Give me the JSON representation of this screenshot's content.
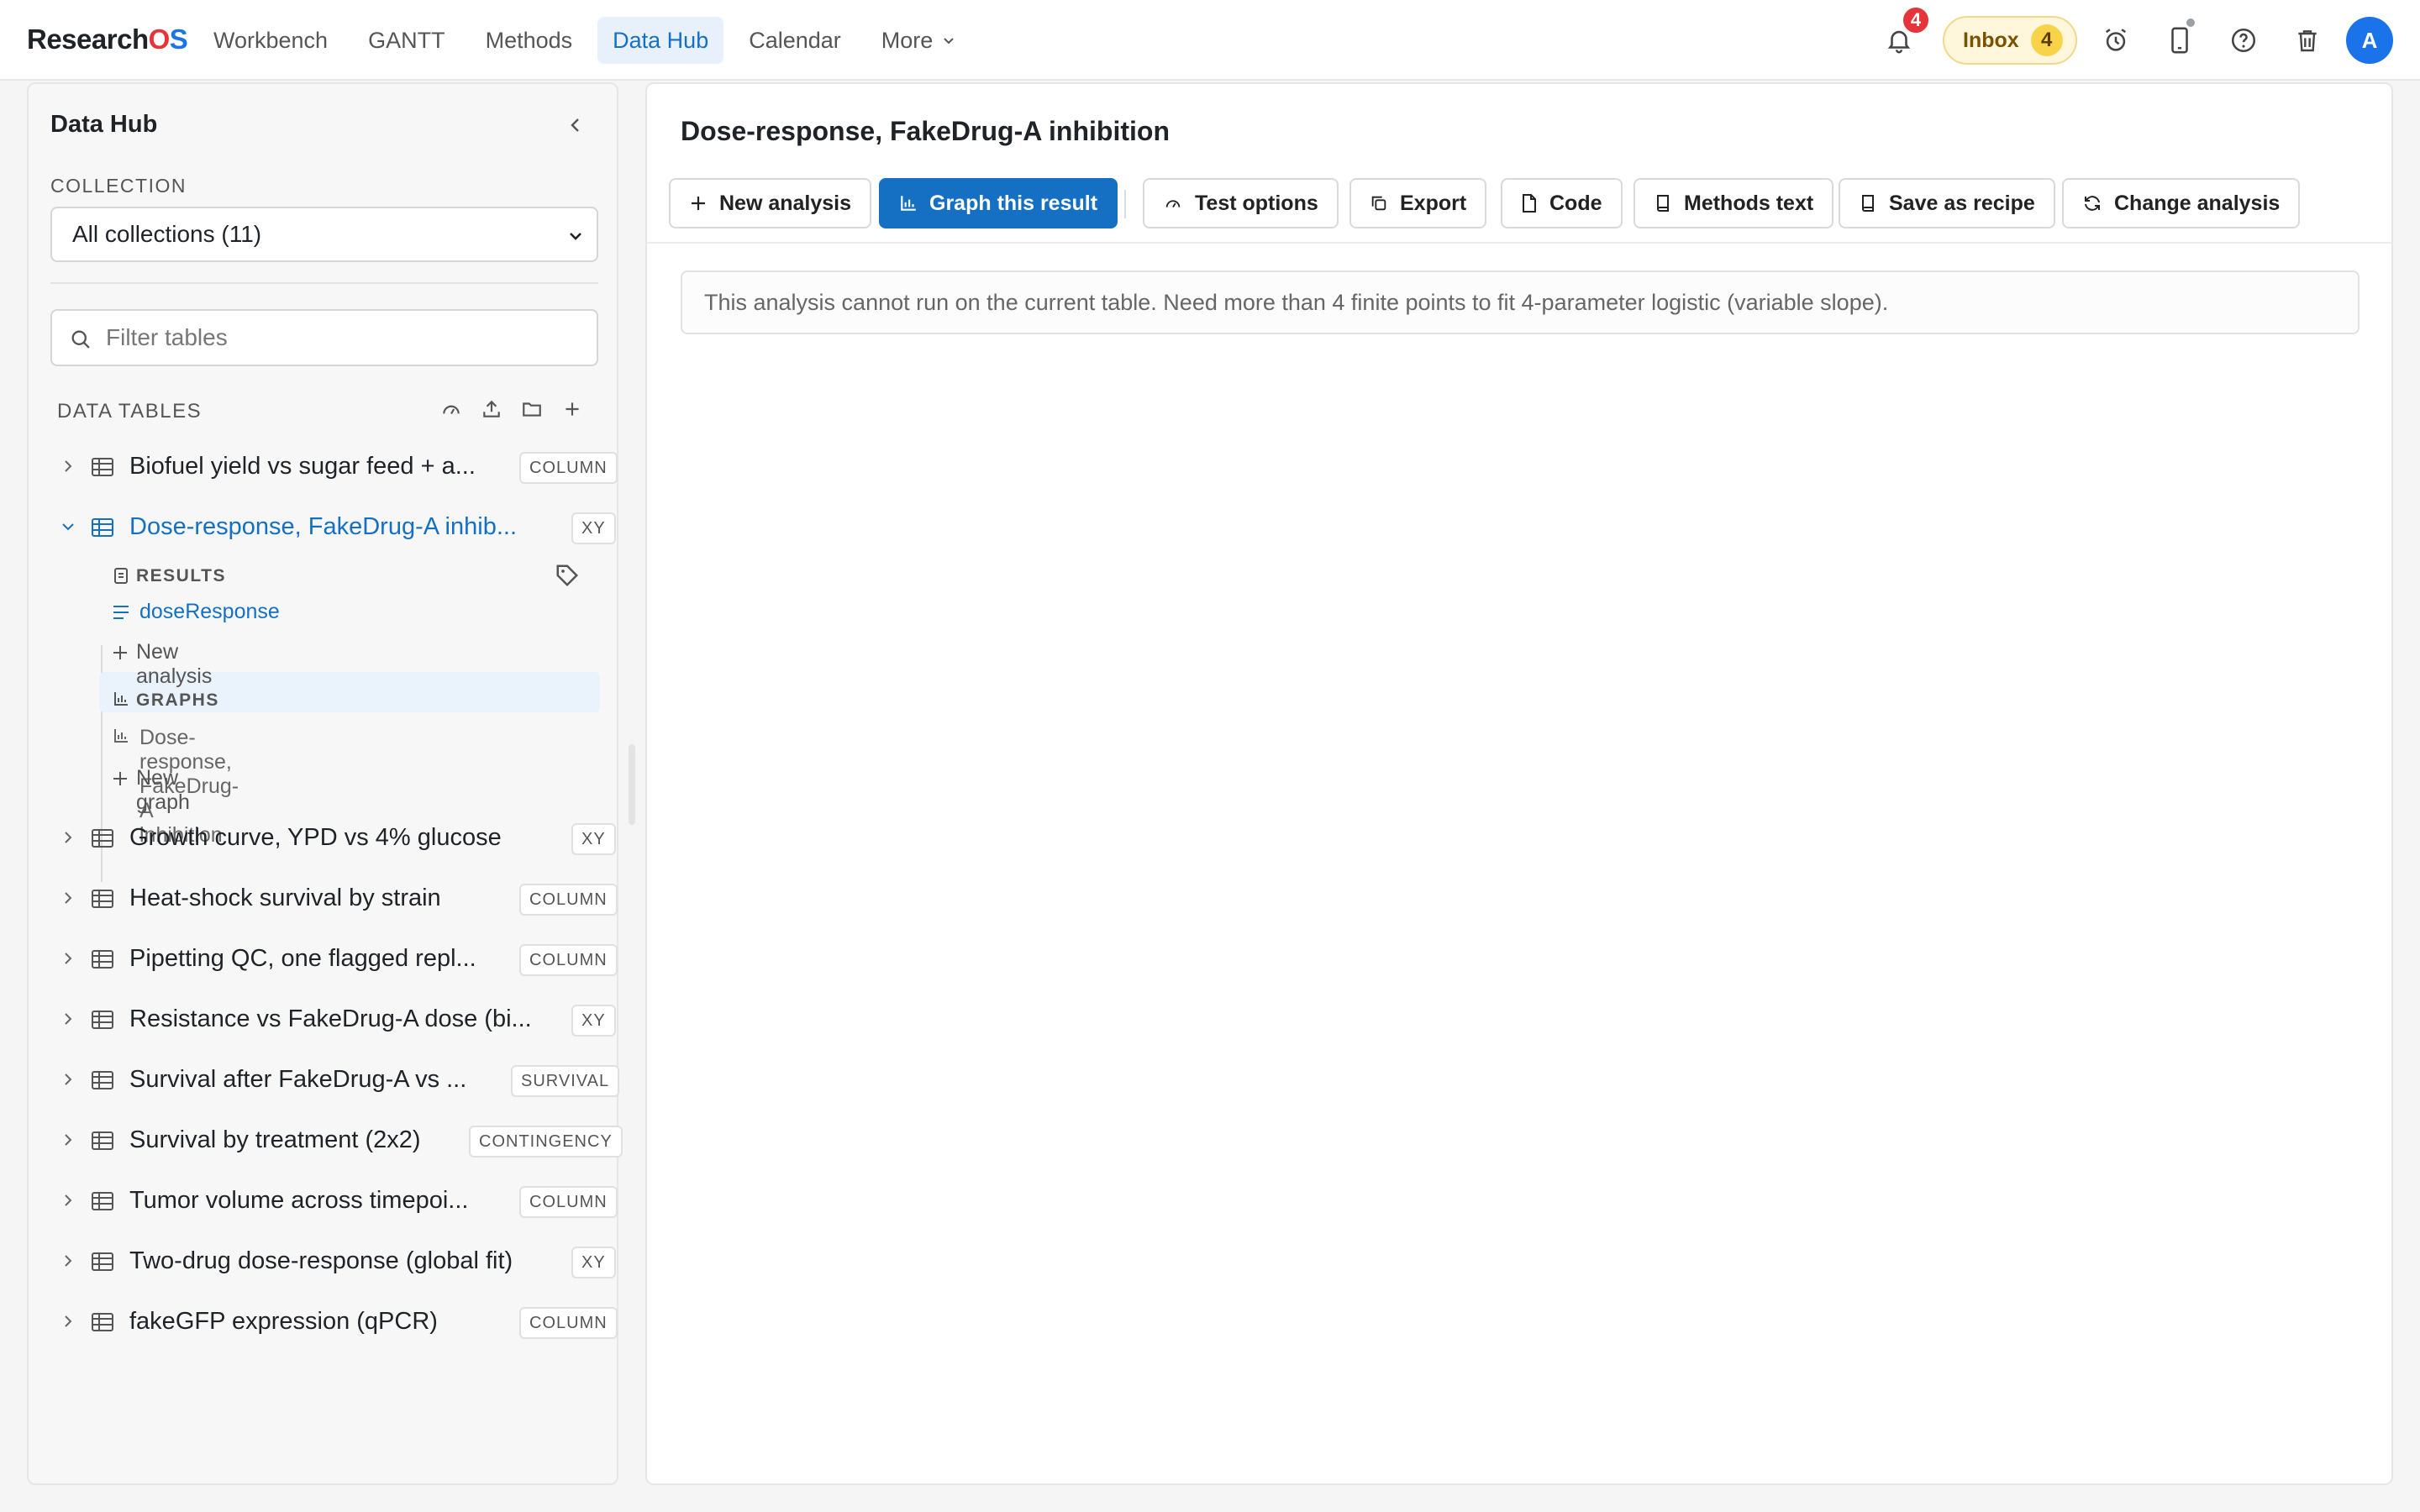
{
  "app": {
    "logo_main": "Research",
    "logo_o": "O",
    "logo_s": "S"
  },
  "nav": {
    "items": [
      "Workbench",
      "GANTT",
      "Methods",
      "Data Hub",
      "Calendar"
    ],
    "more_label": "More",
    "active": "Data Hub"
  },
  "header": {
    "notifications_count": "4",
    "inbox_label": "Inbox",
    "inbox_count": "4",
    "avatar_initial": "A"
  },
  "sidebar": {
    "title": "Data Hub",
    "collection_label": "COLLECTION",
    "collection_value": "All collections (11)",
    "filter_placeholder": "Filter tables",
    "data_tables_label": "DATA TABLES",
    "tables": [
      {
        "name": "Biofuel yield vs sugar feed + a...",
        "tag": "COLUMN"
      },
      {
        "name": "Dose-response, FakeDrug-A inhib...",
        "tag": "XY",
        "selected": true
      },
      {
        "name": "Growth curve, YPD vs 4% glucose",
        "tag": "XY"
      },
      {
        "name": "Heat-shock survival by strain",
        "tag": "COLUMN"
      },
      {
        "name": "Pipetting QC, one flagged repl...",
        "tag": "COLUMN"
      },
      {
        "name": "Resistance vs FakeDrug-A dose (bi...",
        "tag": "XY"
      },
      {
        "name": "Survival after FakeDrug-A vs ...",
        "tag": "SURVIVAL"
      },
      {
        "name": "Survival by treatment (2x2)",
        "tag": "CONTINGENCY"
      },
      {
        "name": "Tumor volume across timepoi...",
        "tag": "COLUMN"
      },
      {
        "name": "Two-drug dose-response (global fit)",
        "tag": "XY"
      },
      {
        "name": "fakeGFP expression (qPCR)",
        "tag": "COLUMN"
      }
    ],
    "expanded": {
      "results_label": "RESULTS",
      "result_item": "doseResponse",
      "new_analysis": "New analysis",
      "graphs_label": "GRAPHS",
      "graph_item": "Dose-response, FakeDrug-A inhibition",
      "new_graph": "New graph"
    }
  },
  "main": {
    "title": "Dose-response, FakeDrug-A inhibition",
    "toolbar": {
      "new_analysis": "New analysis",
      "graph_result": "Graph this result",
      "test_options": "Test options",
      "export": "Export",
      "code": "Code",
      "methods_text": "Methods text",
      "save_recipe": "Save as recipe",
      "change_analysis": "Change analysis"
    },
    "alert": "This analysis cannot run on the current table. Need more than 4 finite points to fit 4-parameter logistic (variable slope)."
  },
  "colors": {
    "accent": "#1570c4",
    "badge": "#e5343a",
    "inbox_bg": "#fff7dc"
  }
}
